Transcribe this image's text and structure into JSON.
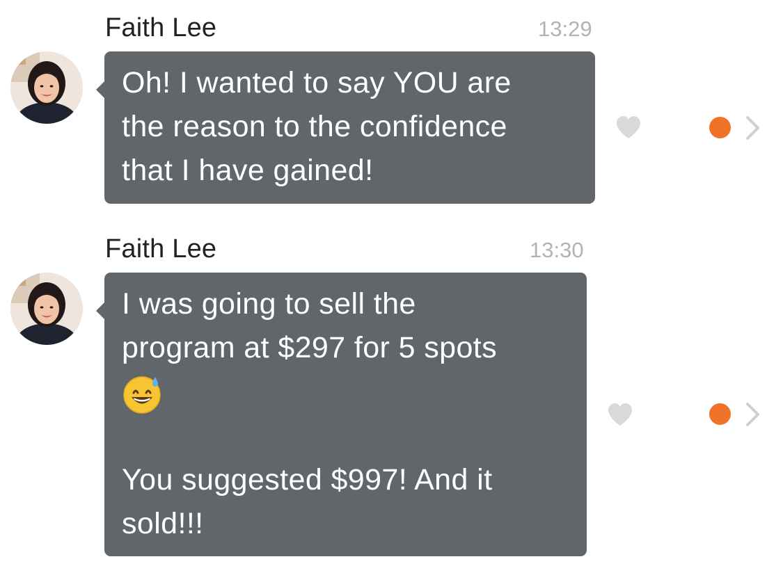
{
  "messages": [
    {
      "sender": "Faith Lee",
      "time": "13:29",
      "lines": [
        "Oh! I wanted to say YOU are",
        "the reason to the confidence",
        "that I have gained!"
      ],
      "avatar_icon": "avatar-photo",
      "like_icon": "heart-icon",
      "status_icon": "status-dot-icon",
      "action_icon": "chevron-right-icon"
    },
    {
      "sender": "Faith Lee",
      "time": "13:30",
      "lines": [
        "I was going to sell the",
        "program at $297 for 5 spots",
        "",
        "",
        "You suggested $997! And it",
        "sold!!!"
      ],
      "emoji_icon": "grinning-face-with-sweat-emoji",
      "avatar_icon": "avatar-photo",
      "like_icon": "heart-icon",
      "status_icon": "status-dot-icon",
      "action_icon": "chevron-right-icon"
    }
  ],
  "colors": {
    "bubble": "#61666b",
    "bubble_text": "#ffffff",
    "sender": "#222222",
    "time": "#b3b3b3",
    "heart": "#d9d9d9",
    "status_dot": "#f07128",
    "chevron": "#cfcfcf"
  }
}
